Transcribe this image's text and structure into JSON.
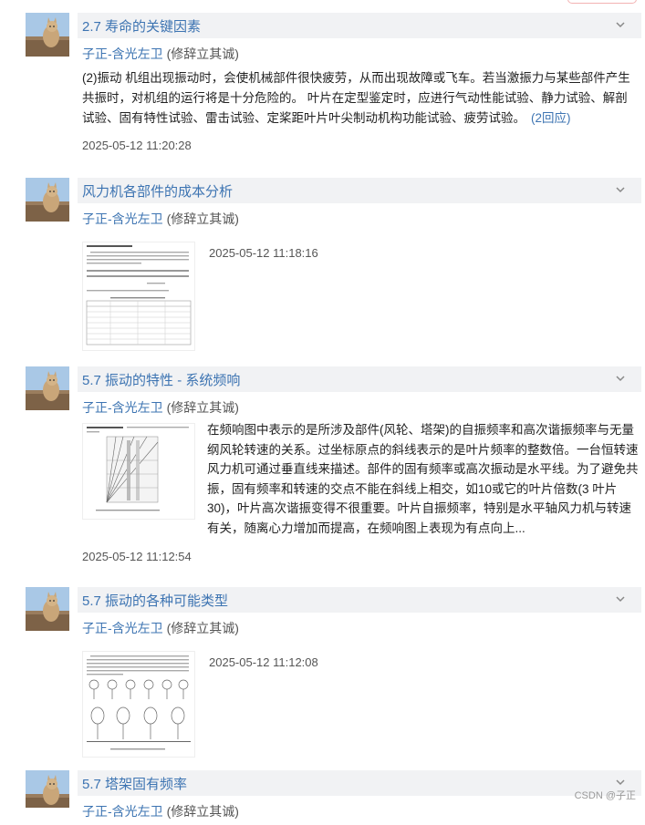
{
  "author": {
    "name": "子正-含光左卫",
    "note": "(修辞立其诚)"
  },
  "posts": [
    {
      "title": "2.7 寿命的关键因素",
      "body": "(2)振动 机组出现振动时，会使机械部件很快疲劳，从而出现故障或飞车。若当激振力与某些部件产生共振时，对机组的运行将是十分危险的。 叶片在定型鉴定时，应进行气动性能试验、静力试验、解剖试验、固有特性试验、雷击试验、定桨距叶片叶尖制动机构功能试验、疲劳试验。",
      "reply": "(2回应)",
      "date": "2025-05-12 11:20:28"
    },
    {
      "title": "风力机各部件的成本分析",
      "date": "2025-05-12 11:18:16"
    },
    {
      "title": "5.7 振动的特性 - 系统频响",
      "body": "在频响图中表示的是所涉及部件(风轮、塔架)的自振频率和高次谐振频率与无量纲风轮转速的关系。过坐标原点的斜线表示的是叶片频率的整数倍。一台恒转速风力机可通过垂直线来描述。部件的固有频率或高次振动是水平线。为了避免共振，固有频率和转速的交点不能在斜线上相交，如10或它的叶片倍数(3 叶片 30)，叶片高次谐振变得不很重要。叶片自振频率，特别是水平轴风力机与转速有关，随离心力增加而提高，在频响图上表现为有点向上...",
      "date": "2025-05-12 11:12:54"
    },
    {
      "title": "5.7 振动的各种可能类型",
      "date": "2025-05-12 11:12:08"
    },
    {
      "title": "5.7 塔架固有频率"
    }
  ],
  "watermark": "CSDN @子正",
  "icons": {
    "collapse": "chevron-down-icon"
  }
}
